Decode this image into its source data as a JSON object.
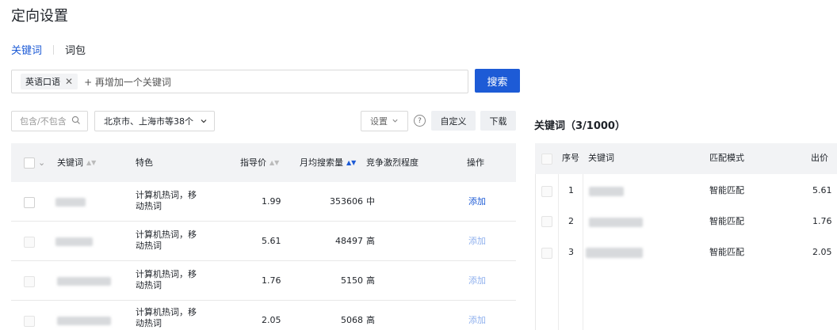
{
  "page": {
    "title": "定向设置"
  },
  "tabs": {
    "keyword": "关键词",
    "package": "词包"
  },
  "keyword_input": {
    "chip": "英语口语",
    "add_placeholder": "+ 再增加一个关键词"
  },
  "search_button": "搜索",
  "filters": {
    "include_placeholder": "包含/不包含",
    "region": "北京市、上海市等38个",
    "settings": "设置",
    "customize": "自定义",
    "download": "下载"
  },
  "left_table": {
    "headers": {
      "keyword": "关键词",
      "feature": "特色",
      "price": "指导价",
      "volume": "月均搜索量",
      "competition": "竞争激烈程度",
      "action": "操作"
    },
    "rows": [
      {
        "feature_line1": "计算机热词，移",
        "feature_line2": "动热词",
        "price": "1.99",
        "volume": "353606",
        "competition": "中",
        "action": "添加"
      },
      {
        "feature_line1": "计算机热词，移",
        "feature_line2": "动热词",
        "price": "5.61",
        "volume": "48497",
        "competition": "高",
        "action": "添加"
      },
      {
        "feature_line1": "计算机热词，移",
        "feature_line2": "动热词",
        "price": "1.76",
        "volume": "5150",
        "competition": "高",
        "action": "添加"
      },
      {
        "feature_line1": "计算机热词，移",
        "feature_line2": "动热词",
        "price": "2.05",
        "volume": "5068",
        "competition": "高",
        "action": "添加"
      }
    ]
  },
  "right_panel": {
    "title": "关键词（3/1000）",
    "headers": {
      "index": "序号",
      "keyword": "关键词",
      "match": "匹配模式",
      "bid": "出价"
    },
    "rows": [
      {
        "index": "1",
        "match": "智能匹配",
        "bid": "5.61"
      },
      {
        "index": "2",
        "match": "智能匹配",
        "bid": "1.76"
      },
      {
        "index": "3",
        "match": "智能匹配",
        "bid": "2.05"
      }
    ]
  },
  "colors": {
    "primary": "#1d5bd6",
    "header_bg": "#f2f3f5",
    "link_disabled": "#8fb0ee"
  }
}
